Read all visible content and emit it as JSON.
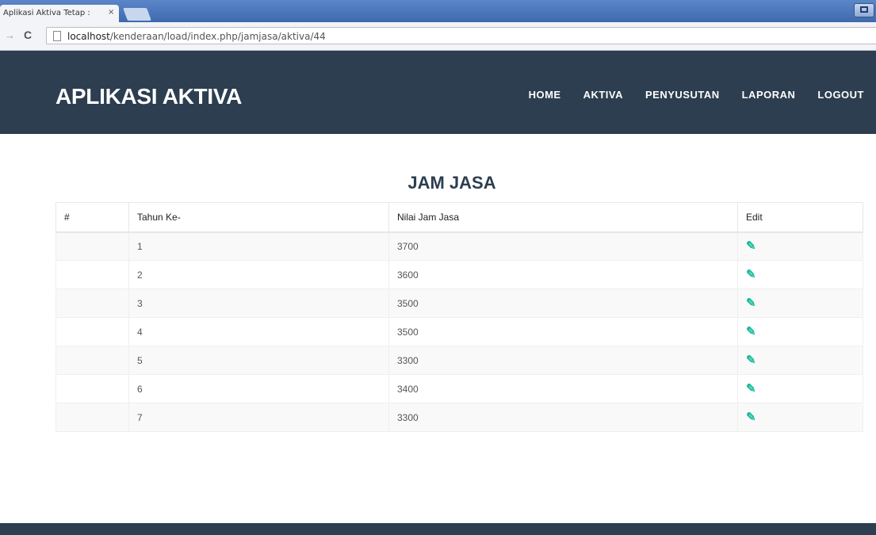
{
  "browser": {
    "tab_title": "Aplikasi Aktiva Tetap :",
    "tab_close": "×",
    "url_host": "localhost",
    "url_path": "/kenderaan/load/index.php/jamjasa/aktiva/44"
  },
  "header": {
    "brand": "APLIKASI AKTIVA",
    "nav": [
      "HOME",
      "AKTIVA",
      "PENYUSUTAN",
      "LAPORAN",
      "LOGOUT"
    ]
  },
  "main": {
    "title": "JAM JASA",
    "columns": [
      "#",
      "Tahun Ke-",
      "Nilai Jam Jasa",
      "Edit"
    ],
    "rows": [
      {
        "num": "",
        "year": "1",
        "value": "3700"
      },
      {
        "num": "",
        "year": "2",
        "value": "3600"
      },
      {
        "num": "",
        "year": "3",
        "value": "3500"
      },
      {
        "num": "",
        "year": "4",
        "value": "3500"
      },
      {
        "num": "",
        "year": "5",
        "value": "3300"
      },
      {
        "num": "",
        "year": "6",
        "value": "3400"
      },
      {
        "num": "",
        "year": "7",
        "value": "3300"
      }
    ]
  },
  "colors": {
    "header_bg": "#2c3e50",
    "accent_green": "#18bc9c"
  },
  "icons": {
    "edit": "edit-icon"
  }
}
